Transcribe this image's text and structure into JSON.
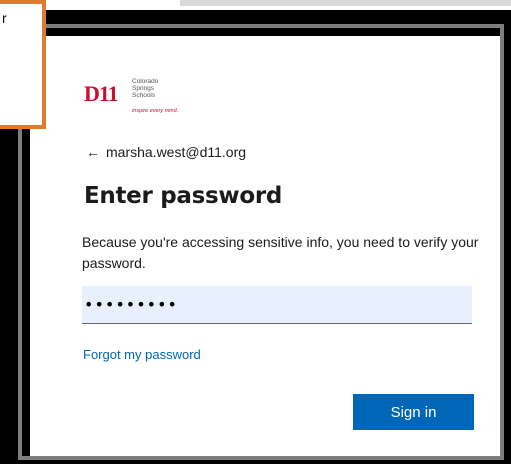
{
  "callout": {
    "text": "r"
  },
  "logo": {
    "mark": "D11",
    "name_line1": "Colorado",
    "name_line2": "Springs",
    "name_line3": "Schools",
    "tagline": "inspire every mind."
  },
  "signin": {
    "back_arrow": "←",
    "account_email": "marsha.west@d11.org",
    "title": "Enter password",
    "description": "Because you're accessing sensitive info, you need to verify your password.",
    "password_value": "•••••••••",
    "forgot_link": "Forgot my password",
    "submit_label": "Sign in"
  },
  "colors": {
    "accent": "#0067b8",
    "brand_red": "#c8102e",
    "input_bg": "#e8f0fe",
    "callout_border": "#e07a2c"
  }
}
